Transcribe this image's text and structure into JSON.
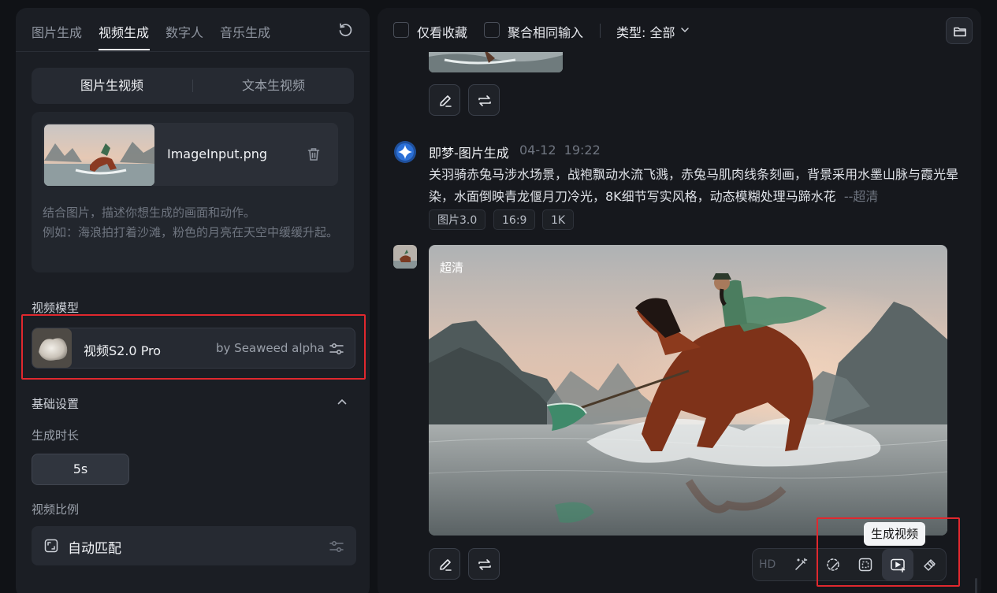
{
  "left": {
    "tabs": [
      "图片生成",
      "视频生成",
      "数字人",
      "音乐生成"
    ],
    "active_tab": "视频生成",
    "mode_segments": [
      "图片生视频",
      "文本生视频"
    ],
    "upload": {
      "file_name": "ImageInput.png",
      "hint_line1": "结合图片，描述你想生成的画面和动作。",
      "hint_line2": "例如：海浪拍打着沙滩，粉色的月亮在天空中缓缓升起。"
    },
    "model_section_label": "视频模型",
    "model": {
      "name": "视频S2.0 Pro",
      "by": "by Seaweed alpha"
    },
    "basic_settings_label": "基础设置",
    "duration_label": "生成时长",
    "duration_value": "5s",
    "ratio_label": "视频比例",
    "ratio_value": "自动匹配"
  },
  "right": {
    "topbar": {
      "favorites_label": "仅看收藏",
      "merge_label": "聚合相同输入",
      "type_select": "类型: 全部"
    },
    "message": {
      "title": "即梦-图片生成",
      "date": "04-12",
      "time": "19:22",
      "prompt": "关羽骑赤兔马涉水场景，战袍飘动水流飞溅，赤兔马肌肉线条刻画，背景采用水墨山脉与霞光晕染，水面倒映青龙偃月刀冷光，8K细节写实风格，动态模糊处理马蹄水花",
      "prompt_suffix": "--超清",
      "chips": [
        "图片3.0",
        "16:9",
        "1K"
      ]
    },
    "image_badge": "超清",
    "toolbar_hd": "HD",
    "tooltip": "生成视频"
  },
  "colors": {
    "highlight_red": "#e0282e",
    "panel_bg": "#1b1e24",
    "page_bg": "#101216"
  }
}
